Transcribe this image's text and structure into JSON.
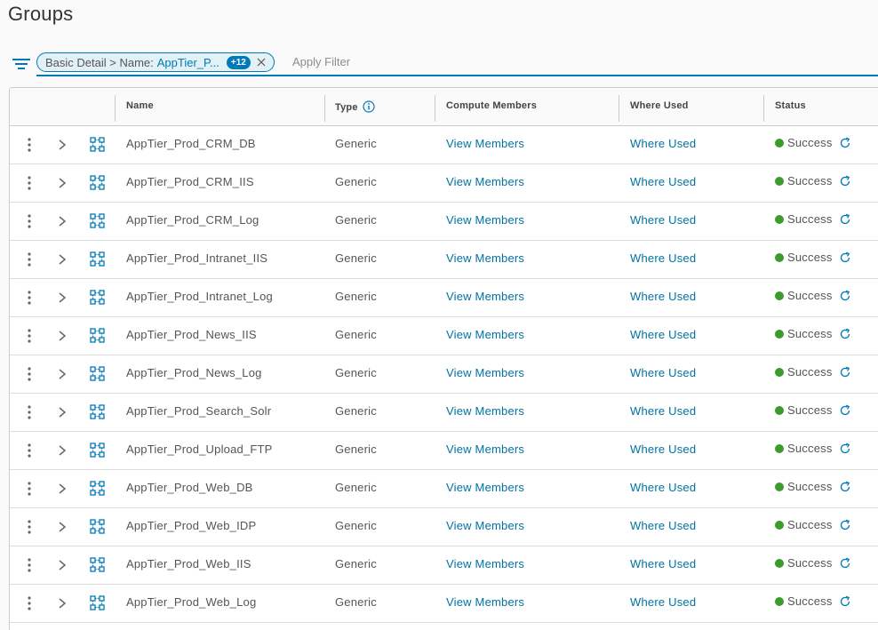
{
  "page": {
    "title": "Groups"
  },
  "filter": {
    "chip_prefix": "Basic Detail > Name:",
    "chip_value": "AppTier_P...",
    "chip_count": "+12",
    "apply_placeholder": "Apply Filter"
  },
  "columns": {
    "name": "Name",
    "type": "Type",
    "compute_members": "Compute Members",
    "where_used": "Where Used",
    "status": "Status"
  },
  "rows": [
    {
      "name": "AppTier_Prod_CRM_DB",
      "type": "Generic",
      "members": "View Members",
      "where_used": "Where Used",
      "status": "Success"
    },
    {
      "name": "AppTier_Prod_CRM_IIS",
      "type": "Generic",
      "members": "View Members",
      "where_used": "Where Used",
      "status": "Success"
    },
    {
      "name": "AppTier_Prod_CRM_Log",
      "type": "Generic",
      "members": "View Members",
      "where_used": "Where Used",
      "status": "Success"
    },
    {
      "name": "AppTier_Prod_Intranet_IIS",
      "type": "Generic",
      "members": "View Members",
      "where_used": "Where Used",
      "status": "Success"
    },
    {
      "name": "AppTier_Prod_Intranet_Log",
      "type": "Generic",
      "members": "View Members",
      "where_used": "Where Used",
      "status": "Success"
    },
    {
      "name": "AppTier_Prod_News_IIS",
      "type": "Generic",
      "members": "View Members",
      "where_used": "Where Used",
      "status": "Success"
    },
    {
      "name": "AppTier_Prod_News_Log",
      "type": "Generic",
      "members": "View Members",
      "where_used": "Where Used",
      "status": "Success"
    },
    {
      "name": "AppTier_Prod_Search_Solr",
      "type": "Generic",
      "members": "View Members",
      "where_used": "Where Used",
      "status": "Success"
    },
    {
      "name": "AppTier_Prod_Upload_FTP",
      "type": "Generic",
      "members": "View Members",
      "where_used": "Where Used",
      "status": "Success"
    },
    {
      "name": "AppTier_Prod_Web_DB",
      "type": "Generic",
      "members": "View Members",
      "where_used": "Where Used",
      "status": "Success"
    },
    {
      "name": "AppTier_Prod_Web_IDP",
      "type": "Generic",
      "members": "View Members",
      "where_used": "Where Used",
      "status": "Success"
    },
    {
      "name": "AppTier_Prod_Web_IIS",
      "type": "Generic",
      "members": "View Members",
      "where_used": "Where Used",
      "status": "Success"
    },
    {
      "name": "AppTier_Prod_Web_Log",
      "type": "Generic",
      "members": "View Members",
      "where_used": "Where Used",
      "status": "Success"
    }
  ],
  "colors": {
    "accent": "#0079b8",
    "link": "#0072a3",
    "success": "#3b9b2b"
  }
}
